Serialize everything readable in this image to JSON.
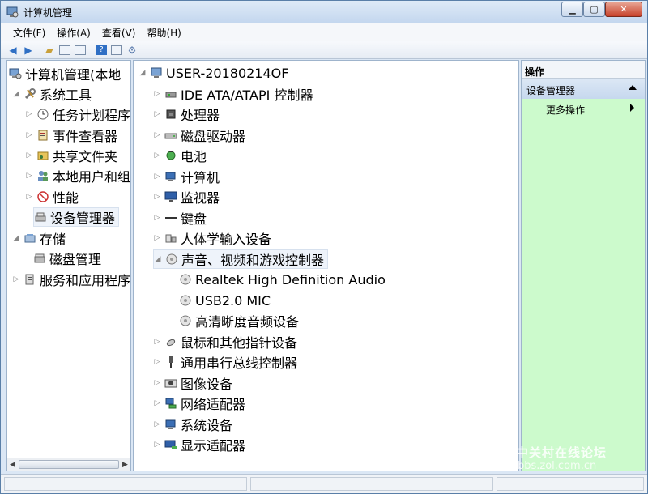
{
  "window": {
    "title": "计算机管理"
  },
  "menu": [
    {
      "label": "文件(F)"
    },
    {
      "label": "操作(A)"
    },
    {
      "label": "查看(V)"
    },
    {
      "label": "帮助(H)"
    }
  ],
  "toolbar": {
    "buttons": [
      "back-arrow-icon",
      "forward-arrow-icon",
      "up-folder-icon",
      "show-hide-tree-icon",
      "export-list-icon",
      "help-icon",
      "properties-icon",
      "scan-hardware-icon"
    ]
  },
  "left_tree": [
    {
      "label": "计算机管理(本地",
      "expander": "",
      "icon": "computer-management-icon"
    },
    {
      "label": "系统工具",
      "expander": "▲",
      "icon": "tools-icon"
    },
    {
      "label": "任务计划程序",
      "expander": "▷",
      "icon": "clock-icon"
    },
    {
      "label": "事件查看器",
      "expander": "▷",
      "icon": "event-viewer-icon"
    },
    {
      "label": "共享文件夹",
      "expander": "▷",
      "icon": "shared-folder-icon"
    },
    {
      "label": "本地用户和组",
      "expander": "▷",
      "icon": "users-icon"
    },
    {
      "label": "性能",
      "expander": "▷",
      "icon": "performance-icon"
    },
    {
      "label": "设备管理器",
      "expander": "",
      "icon": "device-manager-icon"
    },
    {
      "label": "存储",
      "expander": "▲",
      "icon": "storage-icon"
    },
    {
      "label": "磁盘管理",
      "expander": "",
      "icon": "disk-management-icon"
    },
    {
      "label": "服务和应用程序",
      "expander": "▷",
      "icon": "services-icon"
    }
  ],
  "device_tree": {
    "root": "USER-20180214OF",
    "categories": [
      {
        "label": "IDE ATA/ATAPI 控制器",
        "icon": "ide-controller-icon"
      },
      {
        "label": "处理器",
        "icon": "processor-icon"
      },
      {
        "label": "磁盘驱动器",
        "icon": "disk-drive-icon"
      },
      {
        "label": "电池",
        "icon": "battery-icon"
      },
      {
        "label": "计算机",
        "icon": "computer-icon"
      },
      {
        "label": "监视器",
        "icon": "monitor-icon"
      },
      {
        "label": "键盘",
        "icon": "keyboard-icon"
      },
      {
        "label": "人体学输入设备",
        "icon": "hid-icon"
      },
      {
        "label": "声音、视频和游戏控制器",
        "icon": "sound-icon",
        "expanded": true
      },
      {
        "label": "鼠标和其他指针设备",
        "icon": "mouse-icon"
      },
      {
        "label": "通用串行总线控制器",
        "icon": "usb-icon"
      },
      {
        "label": "图像设备",
        "icon": "imaging-icon"
      },
      {
        "label": "网络适配器",
        "icon": "network-icon"
      },
      {
        "label": "系统设备",
        "icon": "system-devices-icon"
      },
      {
        "label": "显示适配器",
        "icon": "display-adapter-icon"
      }
    ],
    "sound_children": [
      {
        "label": "Realtek High Definition Audio"
      },
      {
        "label": "USB2.0 MIC"
      },
      {
        "label": "高清晰度音频设备"
      }
    ]
  },
  "actions": {
    "header": "操作",
    "group": "设备管理器",
    "more": "更多操作"
  },
  "watermark": {
    "logo": "Z",
    "name": "中关村在线论坛",
    "url": "bbs.zol.com.cn"
  }
}
